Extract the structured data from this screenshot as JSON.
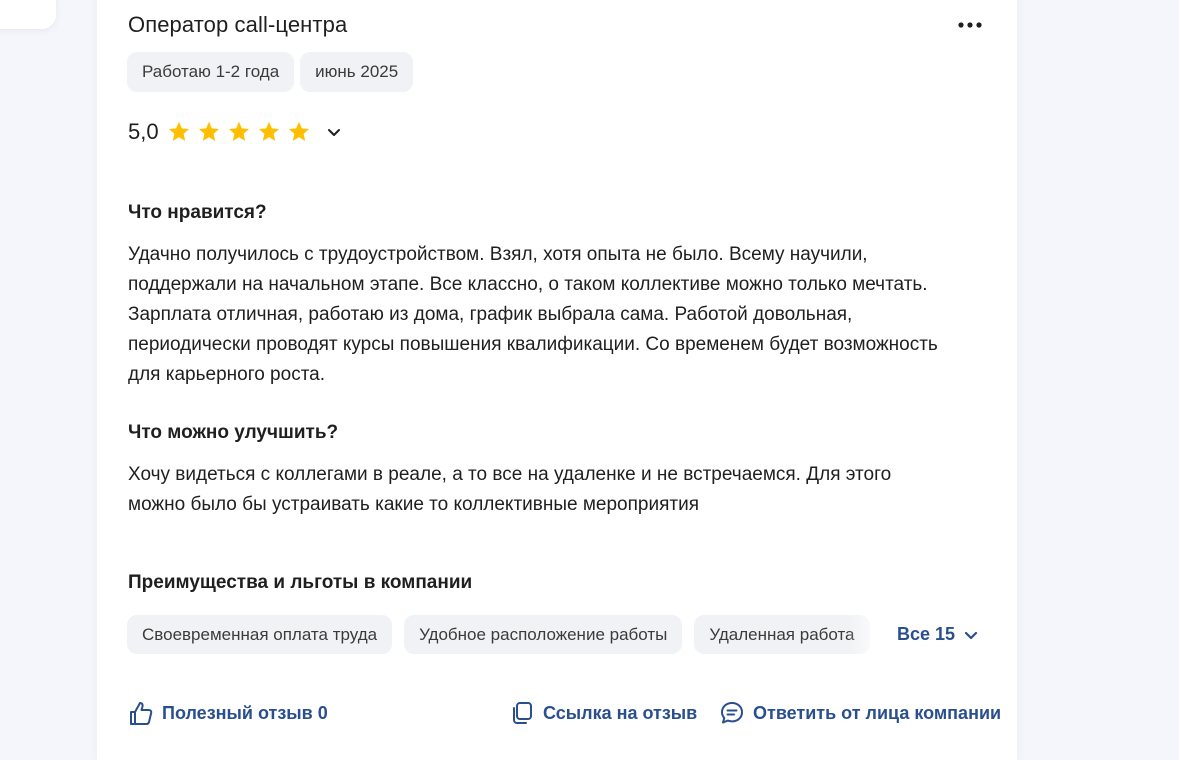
{
  "review": {
    "title": "Оператор call-центра",
    "tags": [
      "Работаю 1-2 года",
      "июнь 2025"
    ],
    "rating": {
      "value": "5,0",
      "stars_filled": 5,
      "stars_total": 5,
      "star_color": "#ffbf00"
    },
    "likes": {
      "heading": "Что нравится?",
      "text": "Удачно получилось с трудоустройством. Взял, хотя опыта не было. Всему научили, поддержали на начальном этапе. Все классно, о таком коллективе можно только мечтать. Зарплата отличная, работаю из дома, график выбрала сама. Работой довольная, периодически проводят курсы повышения квалификации. Со временем будет возможность для карьерного роста."
    },
    "improve": {
      "heading": "Что можно улучшить?",
      "text": "Хочу видеться с коллегами в реале, а то все на удаленке и не встречаемся. Для этого можно было бы устраивать какие то коллективные мероприятия"
    },
    "benefits": {
      "heading": "Преимущества и льготы в компании",
      "items": [
        "Своевременная оплата труда",
        "Удобное расположение работы",
        "Удаленная работа"
      ],
      "all_label": "Все 15"
    },
    "actions": {
      "helpful": "Полезный отзыв 0",
      "link": "Ссылка на отзыв",
      "reply": "Ответить от лица компании"
    },
    "colors": {
      "link": "#2a4f8f",
      "chip_bg": "#f1f2f5"
    }
  }
}
